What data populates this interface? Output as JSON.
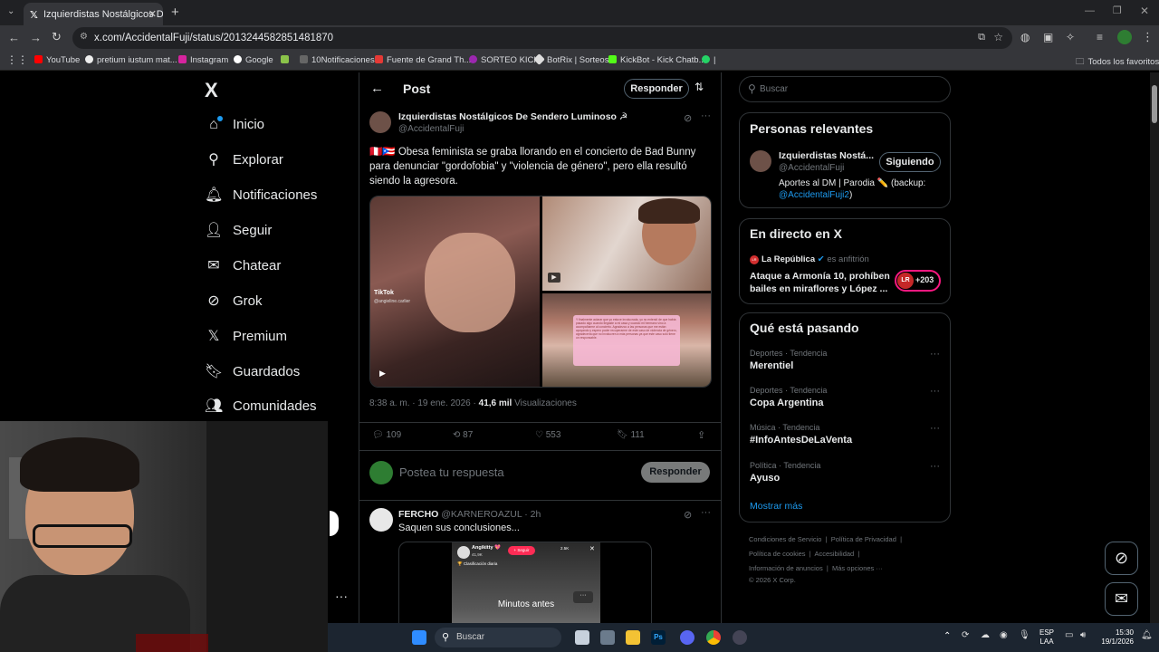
{
  "browser": {
    "tab_title": "Izquierdistas Nostálgicos De Se",
    "url": "x.com/AccidentalFuji/status/2013244582851481870",
    "bookmarks": [
      "YouTube",
      "pretium iustum mat...",
      "Instagram",
      "Google",
      "10Notificaciones",
      "Fuente de Grand Th...",
      "SORTEO KICK",
      "BotRix | Sorteos",
      "KickBot - Kick Chatb...",
      "|"
    ],
    "all_bookmarks": "Todos los favoritos"
  },
  "nav": {
    "logo": "X",
    "items": [
      {
        "label": "Inicio",
        "icon": "home-icon"
      },
      {
        "label": "Explorar",
        "icon": "search-icon"
      },
      {
        "label": "Notificaciones",
        "icon": "bell-icon"
      },
      {
        "label": "Seguir",
        "icon": "follow-icon"
      },
      {
        "label": "Chatear",
        "icon": "mail-icon"
      },
      {
        "label": "Grok",
        "icon": "grok-icon"
      },
      {
        "label": "Premium",
        "icon": "x-icon"
      },
      {
        "label": "Guardados",
        "icon": "bookmark-icon"
      },
      {
        "label": "Comunidades",
        "icon": "people-icon"
      }
    ],
    "more": "···"
  },
  "post_header": {
    "title": "Post",
    "reply_button": "Responder"
  },
  "tweet": {
    "author_name": "Izquierdistas Nostálgicos De Sendero Luminoso ☭",
    "author_handle": "@AccidentalFuji",
    "text": "🇵🇪🇵🇷 Obesa feminista se graba llorando en el concierto de Bad Bunny para denunciar \"gordofobia\" y \"violencia de género\", pero ella resultó siendo la agresora.",
    "time": "8:38 a. m. · 19 ene. 2026 ·",
    "views_count": "41,6 mil",
    "views_label": "Visualizaciones",
    "media": {
      "tiktok_label": "TikTok",
      "tiktok_user": "@angieline.carlier",
      "overlay_text": "Y finalmente aclarar que yo estuve involucrada, yo no entendí de que había pasado algo cuando llegaste a mi casa y cuando mi hermano vino a acompañarme al concierto. Agradezco a las personas que me están apoyando y espero poder recuperarme de este caso de violencia de género, agradecería que no involucren a más personas ya que este caso solo tiene un responsable."
    },
    "stats": {
      "replies": "109",
      "reposts": "87",
      "likes": "553",
      "bookmarks": "111"
    }
  },
  "reply_box": {
    "placeholder": "Postea tu respuesta",
    "button": "Responder"
  },
  "reply": {
    "name": "FERCHO",
    "handle": "@KARNEROAZUL",
    "age": "· 2h",
    "text": "Saquen sus conclusiones...",
    "media": {
      "user": "Angikitty 💖",
      "followers": "41,9K",
      "follow": "+ Seguir",
      "rank": "🏆 Clasificación diaria",
      "count": "2.5K",
      "caption": "Minutos antes"
    }
  },
  "search": {
    "placeholder": "Buscar"
  },
  "relevant": {
    "title": "Personas relevantes",
    "name": "Izquierdistas Nostá...",
    "handle": "@AccidentalFuji",
    "button": "Siguiendo",
    "bio": "Aportes al DM | Parodia ✏️ (backup:",
    "bio_link": "@AccidentalFuji2",
    "bio_end": ")"
  },
  "live": {
    "title": "En directo en X",
    "source": "La República",
    "host": "es anfitrión",
    "headline": "Ataque a Armonía 10, prohíben bailes en miraflores y López ...",
    "badge": "LR",
    "count": "+203"
  },
  "trends": {
    "title": "Qué está pasando",
    "items": [
      {
        "cat": "Deportes · Tendencia",
        "name": "Merentiel"
      },
      {
        "cat": "Deportes · Tendencia",
        "name": "Copa Argentina"
      },
      {
        "cat": "Música · Tendencia",
        "name": "#InfoAntesDeLaVenta"
      },
      {
        "cat": "Política · Tendencia",
        "name": "Ayuso"
      }
    ],
    "more": "Mostrar más"
  },
  "footer": {
    "line1": [
      "Condiciones de Servicio",
      "|",
      "Política de Privacidad",
      "|"
    ],
    "line2": [
      "Política de cookies",
      "|",
      "Accesibilidad",
      "|"
    ],
    "line3": [
      "Información de anuncios",
      "|",
      "Más opciones ···"
    ],
    "copyright": "© 2026 X Corp."
  },
  "taskbar": {
    "search": "Buscar",
    "lang1": "ESP",
    "lang2": "LAA",
    "time": "15:30",
    "date": "19/1/2026"
  },
  "colors": {
    "accent": "#1d9bf0",
    "bg": "#000000",
    "border": "#2f3336",
    "muted": "#71767b"
  }
}
